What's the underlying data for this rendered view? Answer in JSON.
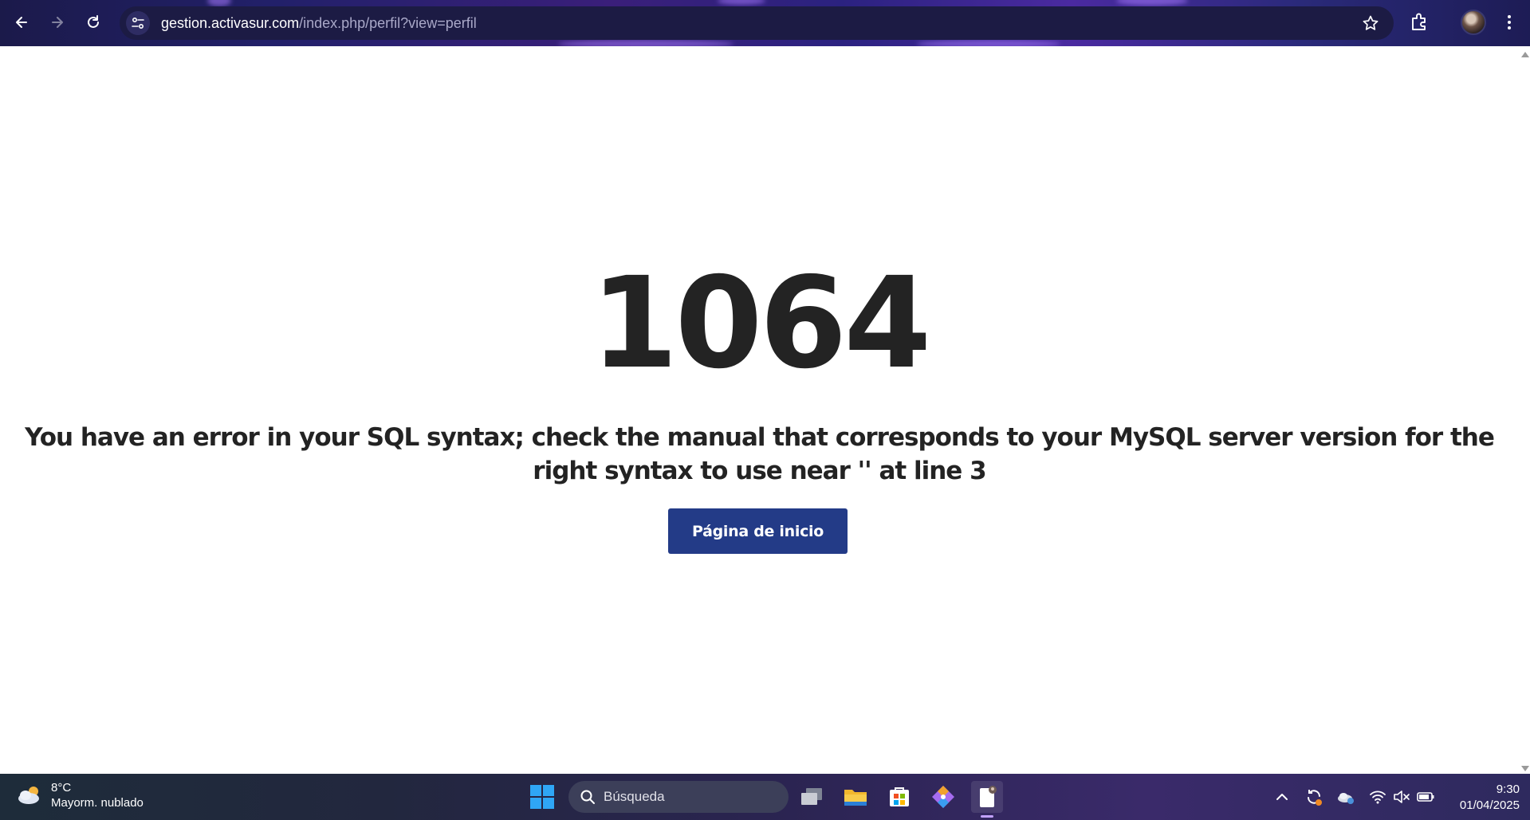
{
  "browser": {
    "url_host": "gestion.activasur.com",
    "url_path": "/index.php/perfil?view=perfil",
    "icons": [
      "back-icon",
      "forward-icon",
      "reload-icon",
      "site-info-icon",
      "star-icon",
      "extensions-icon",
      "avatar",
      "more-icon"
    ]
  },
  "page": {
    "error_code": "1064",
    "error_message": "You have an error in your SQL syntax; check the manual that corresponds to your MySQL server version for the right syntax to use near '' at line 3",
    "home_button": "Página de inicio",
    "button_color": "#233b87",
    "text_color": "#232323"
  },
  "taskbar": {
    "weather_temp": "8°C",
    "weather_desc": "Mayorm. nublado",
    "search_label": "Búsqueda",
    "time": "9:30",
    "date": "01/04/2025",
    "apps": [
      "task-view-icon",
      "file-explorer-icon",
      "ms-store-icon",
      "git-icon",
      "notepad-icon"
    ],
    "tray": [
      "chevron-up-icon",
      "sync-icon",
      "onedrive-icon",
      "wifi-icon",
      "volume-muted-icon",
      "battery-icon"
    ]
  }
}
